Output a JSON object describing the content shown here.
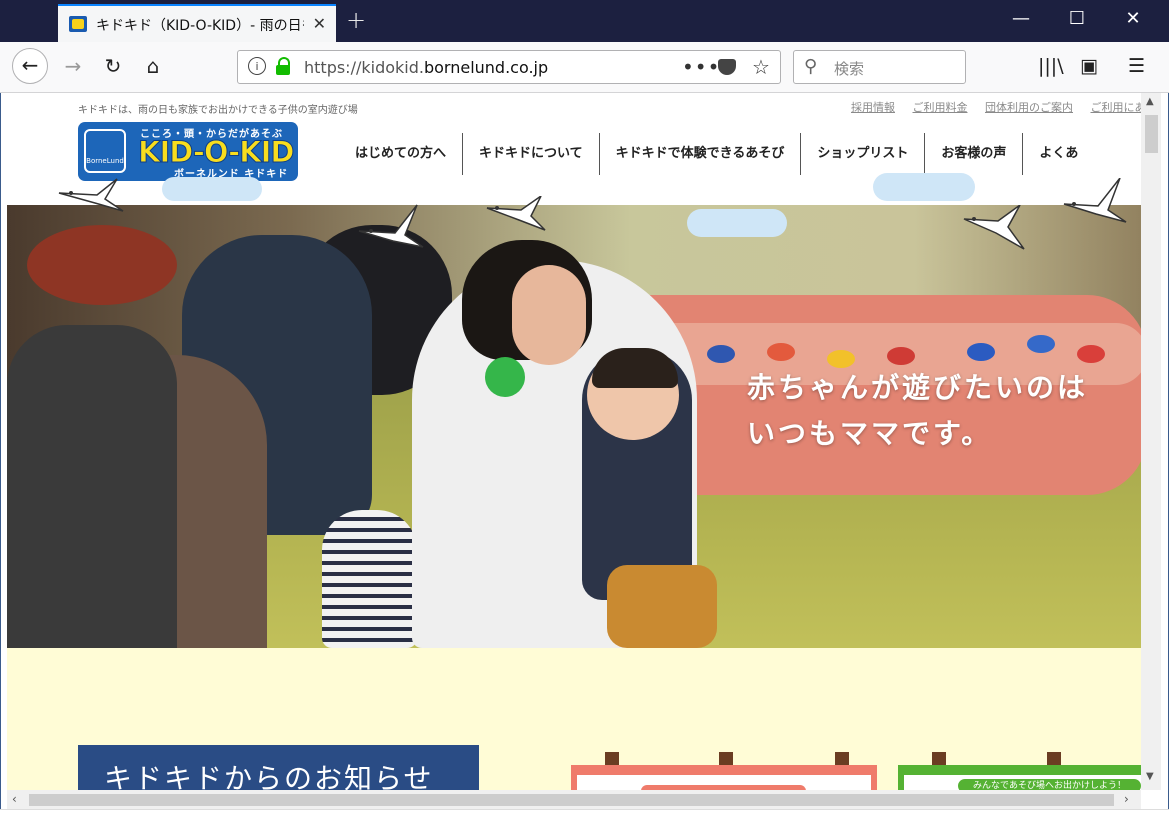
{
  "browser": {
    "tab_title": "キドキド（KID-O-KID）- 雨の日も",
    "tab_close": "✕",
    "new_tab": "+",
    "window_controls": {
      "minimize": "—",
      "maximize": "☐",
      "close": "✕"
    },
    "nav": {
      "back": "←",
      "forward": "→",
      "reload": "↻",
      "home": "⌂"
    },
    "url_prefix": "https://kidokid.",
    "url_domain": "bornelund.co.jp",
    "page_actions": "•••",
    "bookmark_star": "☆",
    "search_placeholder": "検索",
    "search_icon": "⚲",
    "toolbar_right": {
      "library": "|||\\",
      "sidebar": "▣",
      "menu": "☰"
    }
  },
  "page": {
    "tagline": "キドキドは、雨の日も家族でお出かけできる子供の室内遊び場",
    "top_links": [
      "採用情報",
      "ご利用料金",
      "団体利用のご案内",
      "ご利用にあ"
    ],
    "logo": {
      "small": "BorneLund",
      "slogan": "こころ・頭・からだがあそぶ",
      "main": "KID-O-KID",
      "kana": "ボーネルンド キドキド"
    },
    "global_nav": [
      "はじめての方へ",
      "キドキドについて",
      "キドキドで体験できるあそび",
      "ショップリスト",
      "お客様の声",
      "よくあ"
    ],
    "hero": {
      "catch_line1": "赤ちゃんが遊びたいのは",
      "catch_line2": "いつもママです。"
    },
    "news_heading": "キドキドからのお知らせ",
    "board2_label": "みんなであそび場へお出かけしよう！"
  },
  "colors": {
    "brand_blue": "#1d66b9",
    "brand_yellow": "#f8dd1e",
    "page_bg": "#fffcd6",
    "news_bg": "#2a4c85"
  }
}
